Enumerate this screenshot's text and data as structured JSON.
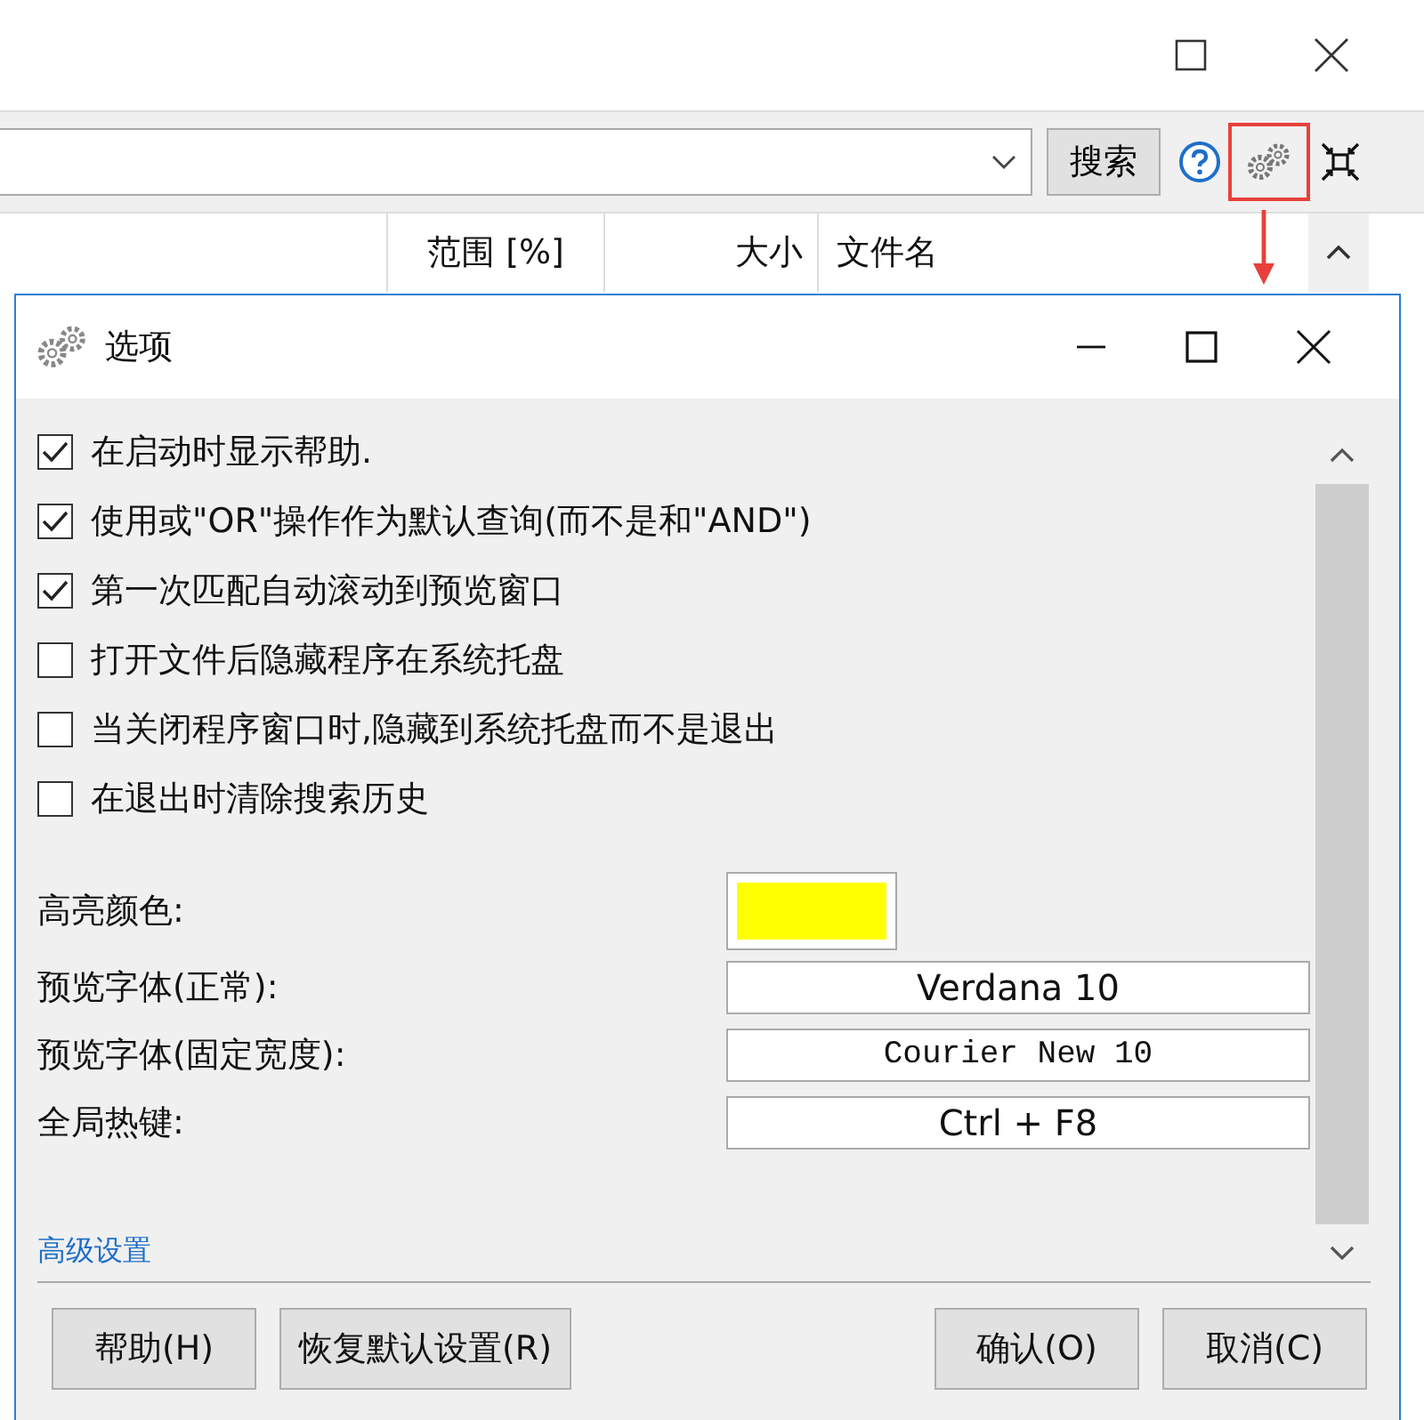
{
  "main_window": {
    "search_button": "搜索",
    "gear_highlighted": true,
    "columns": [
      "范围 [%]",
      "大小",
      "文件名"
    ]
  },
  "dialog": {
    "title": "选项",
    "options": [
      {
        "label": "在启动时显示帮助.",
        "checked": true
      },
      {
        "label": "使用或\"OR\"操作作为默认查询(而不是和\"AND\")",
        "checked": true
      },
      {
        "label": "第一次匹配自动滚动到预览窗口",
        "checked": true
      },
      {
        "label": "打开文件后隐藏程序在系统托盘",
        "checked": false
      },
      {
        "label": "当关闭程序窗口时,隐藏到系统托盘而不是退出",
        "checked": false
      },
      {
        "label": "在退出时清除搜索历史",
        "checked": false
      }
    ],
    "settings": [
      {
        "label": "高亮颜色:",
        "kind": "color",
        "color": "#ffff00"
      },
      {
        "label": "预览字体(正常):",
        "kind": "font",
        "value": "Verdana 10"
      },
      {
        "label": "预览字体(固定宽度):",
        "kind": "mono",
        "value": "Courier New 10"
      },
      {
        "label": "全局热键:",
        "kind": "font",
        "value": "Ctrl + F8"
      }
    ],
    "link": "高级设置",
    "left_buttons": [
      "帮助(H)",
      "恢复默认设置(R)"
    ],
    "right_buttons": [
      "确认(O)",
      "取消(C)"
    ]
  }
}
